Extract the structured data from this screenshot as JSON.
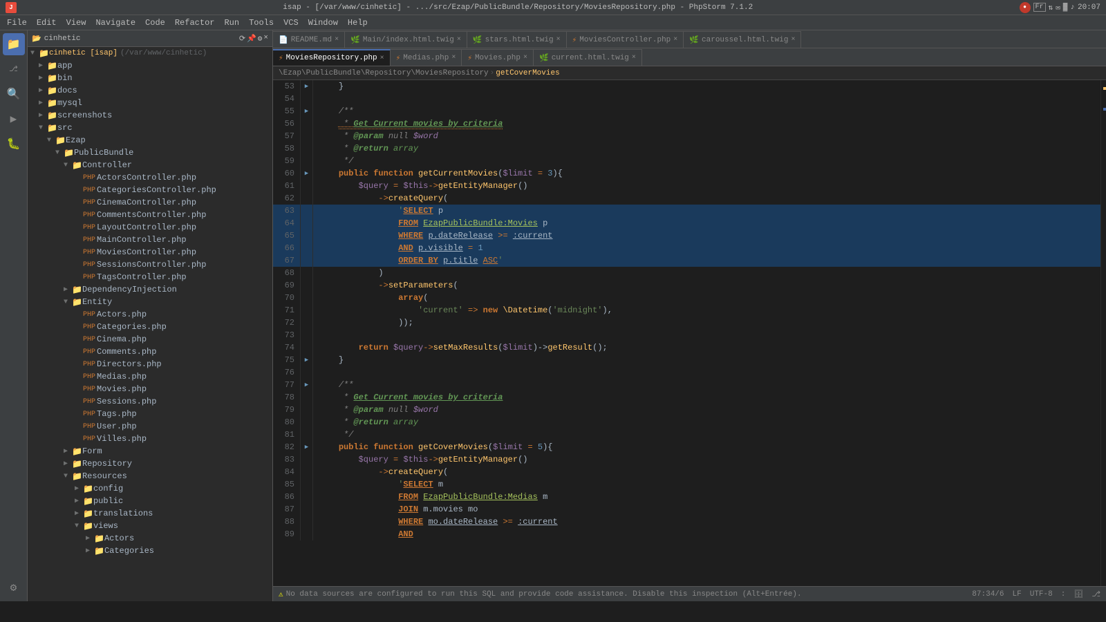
{
  "titleBar": {
    "title": "isap - [/var/www/cinhetic] - .../src/Ezap/PublicBundle/Repository/MoviesRepository.php - PhpStorm 7.1.2",
    "time": "20:07"
  },
  "menuBar": {
    "items": [
      "File",
      "Edit",
      "View",
      "Navigate",
      "Code",
      "Refactor",
      "Run",
      "Tools",
      "VCS",
      "Window",
      "Help"
    ]
  },
  "tabs": {
    "row1": [
      {
        "label": "README.md",
        "type": "md",
        "active": false
      },
      {
        "label": "Main/index.html.twig",
        "type": "twig",
        "active": false
      },
      {
        "label": "stars.html.twig",
        "type": "twig",
        "active": false
      },
      {
        "label": "MoviesController.php",
        "type": "php",
        "active": false
      },
      {
        "label": "caroussel.html.twig",
        "type": "twig",
        "active": false
      }
    ],
    "row2": [
      {
        "label": "MoviesRepository.php",
        "type": "php",
        "active": true
      },
      {
        "label": "Medias.php",
        "type": "php",
        "active": false
      },
      {
        "label": "Movies.php",
        "type": "php",
        "active": false
      },
      {
        "label": "current.html.twig",
        "type": "twig",
        "active": false
      }
    ]
  },
  "breadcrumb": {
    "path": "\\Ezap\\PublicBundle\\Repository\\MoviesRepository",
    "method": "getCoverMovies"
  },
  "sidebar": {
    "projectName": "cinhetic",
    "rootLabel": "cinhetic [isap]",
    "rootPath": "(/var/www/cinhetic)",
    "items": [
      {
        "id": "app",
        "label": "app",
        "type": "folder",
        "level": 1,
        "expanded": false
      },
      {
        "id": "bin",
        "label": "bin",
        "type": "folder",
        "level": 1,
        "expanded": false
      },
      {
        "id": "docs",
        "label": "docs",
        "type": "folder",
        "level": 1,
        "expanded": false
      },
      {
        "id": "mysql",
        "label": "mysql",
        "type": "folder",
        "level": 1,
        "expanded": false
      },
      {
        "id": "screenshots",
        "label": "screenshots",
        "type": "folder",
        "level": 1,
        "expanded": false
      },
      {
        "id": "src",
        "label": "src",
        "type": "folder",
        "level": 1,
        "expanded": true
      },
      {
        "id": "ezap",
        "label": "Ezap",
        "type": "folder",
        "level": 2,
        "expanded": true
      },
      {
        "id": "publicbundle",
        "label": "PublicBundle",
        "type": "folder",
        "level": 3,
        "expanded": true
      },
      {
        "id": "controller",
        "label": "Controller",
        "type": "folder",
        "level": 4,
        "expanded": true
      },
      {
        "id": "actorscontroller",
        "label": "ActorsController.php",
        "type": "php",
        "level": 5
      },
      {
        "id": "categoriescontroller",
        "label": "CategoriesController.php",
        "type": "php",
        "level": 5
      },
      {
        "id": "cinemacontroller",
        "label": "CinemaController.php",
        "type": "php",
        "level": 5
      },
      {
        "id": "commentscontroller",
        "label": "CommentsController.php",
        "type": "php",
        "level": 5
      },
      {
        "id": "layoutcontroller",
        "label": "LayoutController.php",
        "type": "php",
        "level": 5
      },
      {
        "id": "maincontroller",
        "label": "MainController.php",
        "type": "php",
        "level": 5
      },
      {
        "id": "moviescontroller",
        "label": "MoviesController.php",
        "type": "php",
        "level": 5
      },
      {
        "id": "sessionscontroller",
        "label": "SessionsController.php",
        "type": "php",
        "level": 5
      },
      {
        "id": "tagscontroller",
        "label": "TagsController.php",
        "type": "php",
        "level": 5
      },
      {
        "id": "dependencyinjection",
        "label": "DependencyInjection",
        "type": "folder",
        "level": 4,
        "expanded": false
      },
      {
        "id": "entity",
        "label": "Entity",
        "type": "folder",
        "level": 4,
        "expanded": true
      },
      {
        "id": "actors",
        "label": "Actors.php",
        "type": "php",
        "level": 5
      },
      {
        "id": "categories",
        "label": "Categories.php",
        "type": "php",
        "level": 5
      },
      {
        "id": "cinema",
        "label": "Cinema.php",
        "type": "php",
        "level": 5
      },
      {
        "id": "comments",
        "label": "Comments.php",
        "type": "php",
        "level": 5
      },
      {
        "id": "directors",
        "label": "Directors.php",
        "type": "php",
        "level": 5
      },
      {
        "id": "medias",
        "label": "Medias.php",
        "type": "php",
        "level": 5
      },
      {
        "id": "movies",
        "label": "Movies.php",
        "type": "php",
        "level": 5
      },
      {
        "id": "sessions",
        "label": "Sessions.php",
        "type": "php",
        "level": 5
      },
      {
        "id": "tags",
        "label": "Tags.php",
        "type": "php",
        "level": 5
      },
      {
        "id": "user",
        "label": "User.php",
        "type": "php",
        "level": 5
      },
      {
        "id": "villes",
        "label": "Villes.php",
        "type": "php",
        "level": 5
      },
      {
        "id": "form",
        "label": "Form",
        "type": "folder",
        "level": 4,
        "expanded": false
      },
      {
        "id": "repository",
        "label": "Repository",
        "type": "folder",
        "level": 4,
        "expanded": false
      },
      {
        "id": "resources",
        "label": "Resources",
        "type": "folder",
        "level": 4,
        "expanded": true
      },
      {
        "id": "config",
        "label": "config",
        "type": "folder",
        "level": 5,
        "expanded": false
      },
      {
        "id": "public",
        "label": "public",
        "type": "folder",
        "level": 5,
        "expanded": false
      },
      {
        "id": "translations",
        "label": "translations",
        "type": "folder",
        "level": 5,
        "expanded": false
      },
      {
        "id": "views",
        "label": "views",
        "type": "folder",
        "level": 5,
        "expanded": true
      },
      {
        "id": "actorsdir",
        "label": "Actors",
        "type": "folder",
        "level": 6,
        "expanded": false
      },
      {
        "id": "categoriesdir",
        "label": "Categories",
        "type": "folder",
        "level": 6,
        "expanded": false
      }
    ]
  },
  "codeLines": [
    {
      "num": 53,
      "gutter": "▶",
      "highlighted": false,
      "content": "    }"
    },
    {
      "num": 54,
      "gutter": "",
      "highlighted": false,
      "content": ""
    },
    {
      "num": 55,
      "gutter": "▶",
      "highlighted": false,
      "content": "    /**"
    },
    {
      "num": 56,
      "gutter": "",
      "highlighted": false,
      "content": "     * Get Current movies by criteria"
    },
    {
      "num": 57,
      "gutter": "",
      "highlighted": false,
      "content": "     * @param null $word"
    },
    {
      "num": 58,
      "gutter": "",
      "highlighted": false,
      "content": "     * @return array"
    },
    {
      "num": 59,
      "gutter": "",
      "highlighted": false,
      "content": "     */"
    },
    {
      "num": 60,
      "gutter": "▶",
      "highlighted": false,
      "content": "    public function getCurrentMovies($limit = 3){"
    },
    {
      "num": 61,
      "gutter": "",
      "highlighted": false,
      "content": "        $query = $this->getEntityManager()"
    },
    {
      "num": 62,
      "gutter": "",
      "highlighted": false,
      "content": "            ->createQuery("
    },
    {
      "num": 63,
      "gutter": "",
      "highlighted": true,
      "content": "                'SELECT p"
    },
    {
      "num": 64,
      "gutter": "",
      "highlighted": true,
      "content": "                FROM EzapPublicBundle:Movies p"
    },
    {
      "num": 65,
      "gutter": "",
      "highlighted": true,
      "content": "                WHERE p.dateRelease >= :current"
    },
    {
      "num": 66,
      "gutter": "",
      "highlighted": true,
      "content": "                AND p.visible = 1"
    },
    {
      "num": 67,
      "gutter": "",
      "highlighted": true,
      "content": "                ORDER BY p.title ASC'"
    },
    {
      "num": 68,
      "gutter": "",
      "highlighted": false,
      "content": "            )"
    },
    {
      "num": 69,
      "gutter": "",
      "highlighted": false,
      "content": "            ->setParameters("
    },
    {
      "num": 70,
      "gutter": "",
      "highlighted": false,
      "content": "                array("
    },
    {
      "num": 71,
      "gutter": "",
      "highlighted": false,
      "content": "                    'current' => new \\Datetime('midnight'),"
    },
    {
      "num": 72,
      "gutter": "",
      "highlighted": false,
      "content": "                ));"
    },
    {
      "num": 73,
      "gutter": "",
      "highlighted": false,
      "content": ""
    },
    {
      "num": 74,
      "gutter": "",
      "highlighted": false,
      "content": "        return $query->setMaxResults($limit)->getResult();"
    },
    {
      "num": 75,
      "gutter": "▶",
      "highlighted": false,
      "content": "    }"
    },
    {
      "num": 76,
      "gutter": "",
      "highlighted": false,
      "content": ""
    },
    {
      "num": 77,
      "gutter": "▶",
      "highlighted": false,
      "content": "    /**"
    },
    {
      "num": 78,
      "gutter": "",
      "highlighted": false,
      "content": "     * Get Current movies by criteria"
    },
    {
      "num": 79,
      "gutter": "",
      "highlighted": false,
      "content": "     * @param null $word"
    },
    {
      "num": 80,
      "gutter": "",
      "highlighted": false,
      "content": "     * @return array"
    },
    {
      "num": 81,
      "gutter": "",
      "highlighted": false,
      "content": "     */"
    },
    {
      "num": 82,
      "gutter": "▶",
      "highlighted": false,
      "content": "    public function getCoverMovies($limit = 5){"
    },
    {
      "num": 83,
      "gutter": "",
      "highlighted": false,
      "content": "        $query = $this->getEntityManager()"
    },
    {
      "num": 84,
      "gutter": "",
      "highlighted": false,
      "content": "            ->createQuery("
    },
    {
      "num": 85,
      "gutter": "",
      "highlighted": false,
      "content": "                'SELECT m"
    },
    {
      "num": 86,
      "gutter": "",
      "highlighted": false,
      "content": "                FROM EzapPublicBundle:Medias m"
    },
    {
      "num": 87,
      "gutter": "",
      "highlighted": false,
      "content": "                JOIN m.movies mo"
    },
    {
      "num": 88,
      "gutter": "",
      "highlighted": false,
      "content": "                WHERE mo.dateRelease >= :current"
    },
    {
      "num": 89,
      "gutter": "",
      "highlighted": false,
      "content": "                AND"
    }
  ],
  "statusBar": {
    "warning": "No data sources are configured to run this SQL and provide code assistance. Disable this inspection (Alt+Entrée).",
    "position": "87:34/6",
    "lf": "LF",
    "encoding": "UTF-8",
    "extra": ":"
  }
}
